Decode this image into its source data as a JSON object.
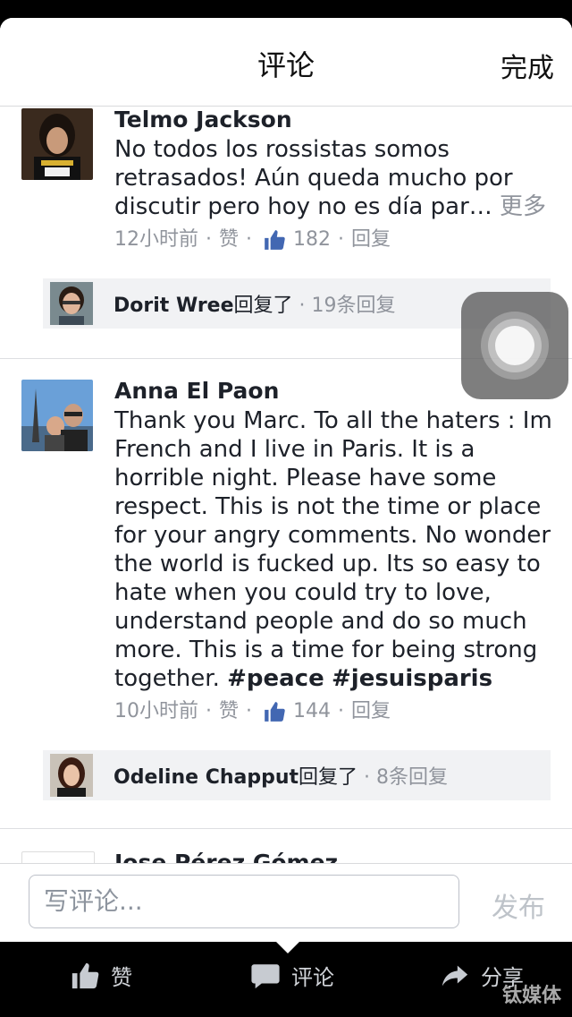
{
  "header": {
    "title": "评论",
    "done_label": "完成"
  },
  "comments": [
    {
      "author": "Telmo Jackson",
      "text": "No todos los rossistas somos retrasados! Aún queda mucho por discutir pero hoy no es día par…",
      "more_label": "更多",
      "time": "12小时前",
      "like_label": "赞",
      "likes": "182",
      "reply_label": "回复",
      "reply_summary": {
        "name": "Dorit Wree",
        "action": "回复了",
        "count": "19条回复"
      }
    },
    {
      "author": "Anna El Paon",
      "text": "Thank you Marc. To all the haters : Im French and I live in Paris. It is a horrible night. Please have some respect. This is not the time or place for your angry comments. No wonder the world is fucked up. Its so easy to hate when you could try to love, understand people and do so much more. This is a time for being strong together.",
      "hashtags": [
        "#peace",
        "#jesuisparis"
      ],
      "time": "10小时前",
      "like_label": "赞",
      "likes": "144",
      "reply_label": "回复",
      "reply_summary": {
        "name": "Odeline Chapput",
        "action": "回复了",
        "count": "8条回复"
      }
    },
    {
      "author": "Jose Pérez Gómez"
    }
  ],
  "composer": {
    "placeholder": "写评论...",
    "post_label": "发布"
  },
  "tabbar": {
    "like_label": "赞",
    "comment_label": "评论",
    "share_label": "分享"
  },
  "watermark": "钛媒体",
  "colors": {
    "accent": "#4267b2",
    "meta": "#90949c",
    "text": "#1d2129"
  },
  "icons": [
    "like-icon",
    "comment-icon",
    "share-icon",
    "assistive-touch-icon"
  ]
}
